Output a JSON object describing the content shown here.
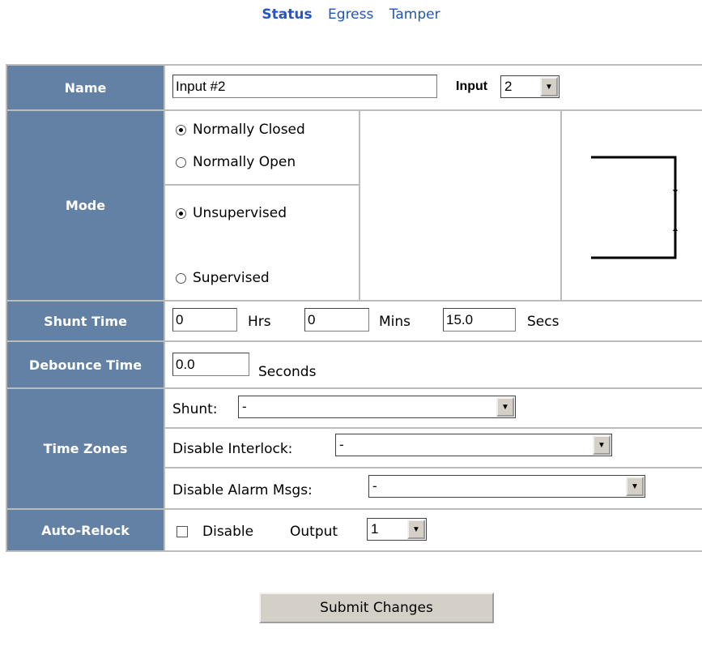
{
  "nav": {
    "status": "Status",
    "egress": "Egress",
    "tamper": "Tamper"
  },
  "name_row": {
    "label": "Name",
    "value": "Input #2",
    "input_label": "Input",
    "input_value": "2"
  },
  "mode": {
    "label": "Mode",
    "normally_closed": "Normally Closed",
    "normally_open": "Normally Open",
    "unsupervised": "Unsupervised",
    "supervised": "Supervised",
    "selected_contact": "Normally Closed",
    "selected_supervision": "Unsupervised"
  },
  "shunt_time": {
    "label": "Shunt Time",
    "hrs": "0",
    "hrs_unit": "Hrs",
    "mins": "0",
    "mins_unit": "Mins",
    "secs": "15.0",
    "secs_unit": "Secs"
  },
  "debounce_time": {
    "label": "Debounce Time",
    "value": "0.0",
    "unit": "Seconds"
  },
  "time_zones": {
    "label": "Time Zones",
    "shunt_label": "Shunt:",
    "shunt_value": "-",
    "interlock_label": "Disable Interlock:",
    "interlock_value": "-",
    "alarm_label": "Disable Alarm Msgs:",
    "alarm_value": "-"
  },
  "auto_relock": {
    "label": "Auto-Relock",
    "disable_label": "Disable",
    "disable_checked": false,
    "output_label": "Output",
    "output_value": "1"
  },
  "submit_label": "Submit Changes",
  "colors": {
    "label_bg": "#6281a4",
    "grid": "#bcbcbc",
    "link": "#2255bb"
  }
}
